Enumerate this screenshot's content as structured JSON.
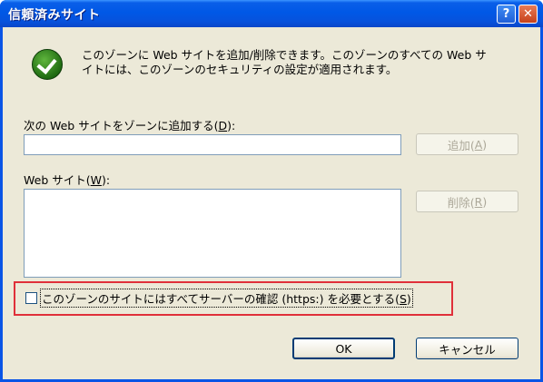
{
  "dialog": {
    "title": "信頼済みサイト",
    "help_glyph": "?",
    "close_glyph": "✕"
  },
  "description": {
    "line1": "このゾーンに Web サイトを追加/削除できます。このゾーンのすべての Web サ",
    "line2": "イトには、このゾーンのセキュリティの設定が適用されます。"
  },
  "add_site": {
    "label": "次の Web サイトをゾーンに追加する(",
    "label_key": "D",
    "label_end": "):",
    "value": "",
    "button_label": "追加(",
    "button_key": "A",
    "button_end": ")"
  },
  "websites": {
    "label": "Web サイト(",
    "label_key": "W",
    "label_end": "):",
    "items": [],
    "remove_label": "削除(",
    "remove_key": "R",
    "remove_end": ")"
  },
  "https_option": {
    "label": "このゾーンのサイトにはすべてサーバーの確認 (https:) を必要とする(",
    "label_key": "S",
    "label_end": ")",
    "checked": false
  },
  "footer": {
    "ok_label": "OK",
    "cancel_label": "キャンセル"
  }
}
